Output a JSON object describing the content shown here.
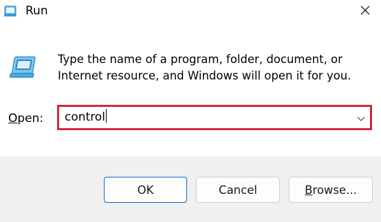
{
  "window": {
    "title": "Run",
    "close_label": "Close"
  },
  "description": {
    "line1": "Type the name of a program, folder, document, or",
    "line2": "Internet resource, and Windows will open it for you."
  },
  "open_field": {
    "label_mnemonic": "O",
    "label_rest": "pen:",
    "value": "control",
    "highlight_color": "#d1283a"
  },
  "buttons": {
    "ok": "OK",
    "cancel": "Cancel",
    "browse_mnemonic": "B",
    "browse_rest": "rowse..."
  },
  "icons": {
    "title_icon": "run-icon",
    "main_icon": "run-icon",
    "close_icon": "close-icon",
    "dropdown_icon": "chevron-down-icon"
  }
}
